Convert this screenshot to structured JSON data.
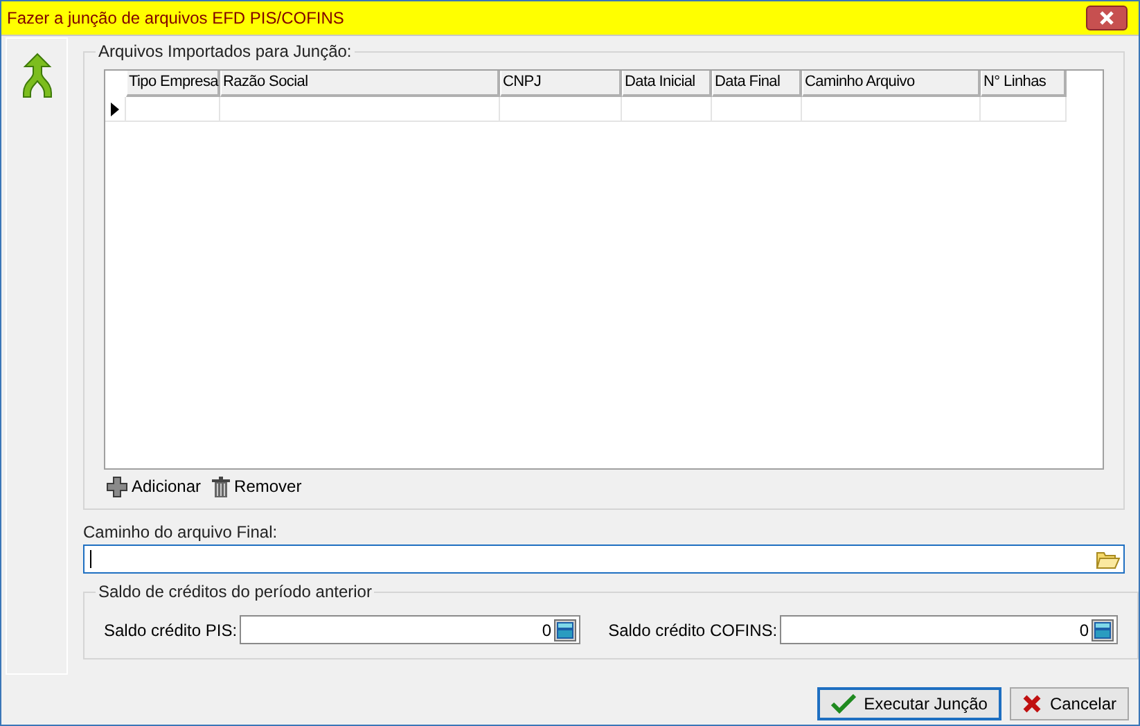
{
  "window": {
    "title": "Fazer a junção de arquivos EFD PIS/COFINS"
  },
  "imported_group": {
    "title": "Arquivos Importados para Junção:"
  },
  "table": {
    "columns": [
      "Tipo Empresa",
      "Razão Social",
      "CNPJ",
      "Data Inicial",
      "Data Final",
      "Caminho Arquivo",
      "N° Linhas"
    ],
    "rows": [
      {
        "current": true
      }
    ]
  },
  "grid_actions": [
    "Adicionar",
    "Remover"
  ],
  "final_path": {
    "label": "Caminho do arquivo Final:",
    "focused": true
  },
  "credits_group": {
    "title": "Saldo de créditos do período anterior",
    "fields": [
      {
        "label": "Saldo crédito PIS:",
        "value": "0"
      },
      {
        "label": "Saldo crédito COFINS:",
        "value": "0"
      }
    ]
  },
  "buttons": [
    {
      "kind": "ok",
      "label": "Executar Junção",
      "default": true
    },
    {
      "kind": "cancel",
      "label": "Cancelar",
      "default": false
    }
  ]
}
